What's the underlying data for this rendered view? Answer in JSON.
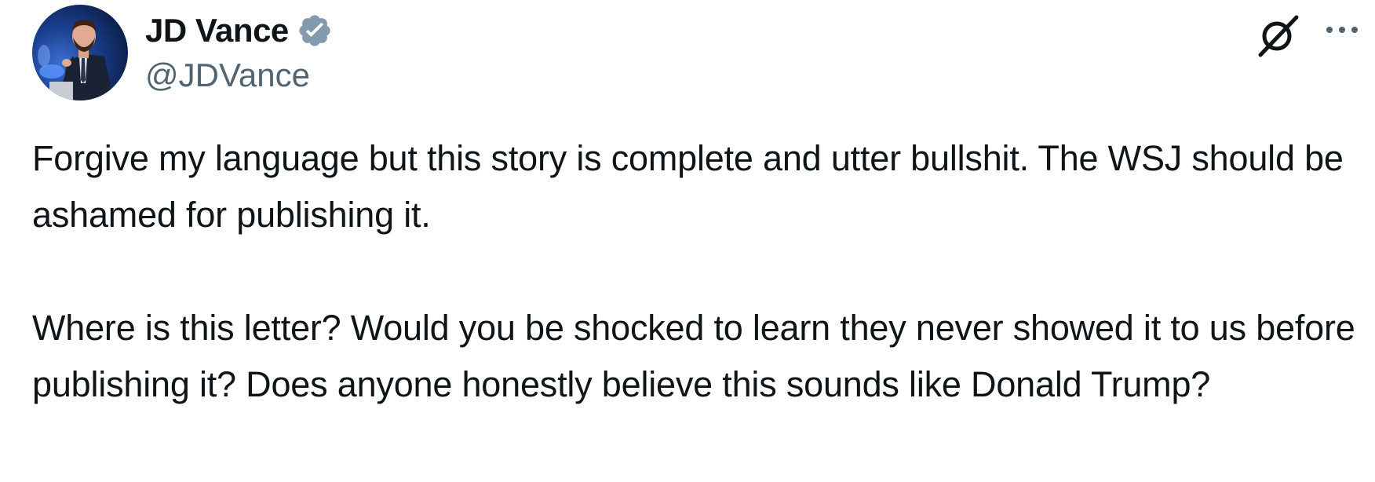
{
  "author": {
    "display_name": "JD Vance",
    "handle": "@JDVance",
    "verified": true,
    "verified_color": "#829aab"
  },
  "actions": {
    "grok_icon": "grok-icon",
    "more_icon": "more-options-icon"
  },
  "tweet": {
    "paragraphs": [
      "Forgive my language but this story is complete and utter bullshit. The WSJ should be ashamed for publishing it.",
      "Where is this letter? Would you be shocked to learn they never showed it to us before publishing it? Does anyone honestly believe this sounds like Donald Trump?"
    ]
  },
  "colors": {
    "text": "#0f1419",
    "secondary_text": "#536471",
    "background": "#ffffff"
  }
}
